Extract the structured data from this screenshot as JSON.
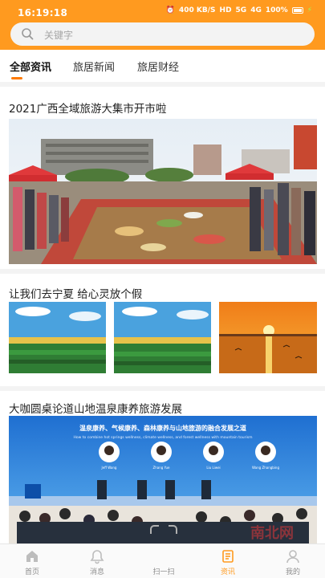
{
  "status_bar": {
    "time": "16:19:18",
    "net_speed": "400 KB/S",
    "hd": "HD",
    "signal1": "5G",
    "signal2": "4G",
    "battery": "100%"
  },
  "search": {
    "placeholder": "关键字",
    "icon": "search-icon"
  },
  "tabs": [
    {
      "label": "全部资讯",
      "active": true
    },
    {
      "label": "旅居新闻",
      "active": false
    },
    {
      "label": "旅居财经",
      "active": false
    }
  ],
  "articles": [
    {
      "title": "2021广西全域旅游大集市开市啦"
    },
    {
      "title": "让我们去宁夏 给心灵放个假"
    },
    {
      "title": "大咖圆桌论道山地温泉康养旅游发展"
    }
  ],
  "banner_text": {
    "headline": "温泉康养、气候康养、森林康养与山地旅游的融合发展之道",
    "subline": "How to combine hot springs wellness, climate wellness, and forest wellness with mountain tourism",
    "speakers": [
      "Jeff Wang",
      "Zhang Yue",
      "Liu Liwei",
      "Wang Zhangbing"
    ]
  },
  "watermark": "南北网",
  "bottom_nav": [
    {
      "label": "首页",
      "icon": "home-icon",
      "active": false
    },
    {
      "label": "消息",
      "icon": "bell-icon",
      "active": false
    },
    {
      "label": "扫一扫",
      "icon": "scan-icon",
      "active": false
    },
    {
      "label": "资讯",
      "icon": "news-icon",
      "active": true
    },
    {
      "label": "我的",
      "icon": "user-icon",
      "active": false
    }
  ],
  "colors": {
    "accent": "#ff9a1f",
    "tab_underline": "#ff7a00",
    "inactive": "#8e8e8e"
  }
}
